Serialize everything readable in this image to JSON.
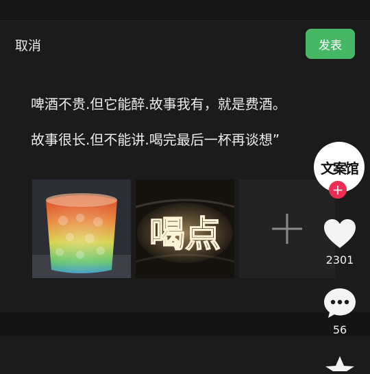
{
  "header": {
    "cancel_label": "取消",
    "publish_label": "发表"
  },
  "post": {
    "lines": [
      "啤酒不贵.但它能醉.故事我有，就是费酒。",
      "故事很长.但不能讲.喝完最后一杯再谈想”"
    ]
  },
  "images": [
    {
      "name": "rainbow-drink-glass"
    },
    {
      "name": "neon-sign",
      "sign_text": "喝点"
    }
  ],
  "sidebar": {
    "avatar_text": "文案馆",
    "follow_symbol": "+",
    "like_count": "2301",
    "comment_count": "56"
  },
  "colors": {
    "publish": "#46b865",
    "follow": "#ee2d53",
    "background": "#1b1b1b"
  }
}
